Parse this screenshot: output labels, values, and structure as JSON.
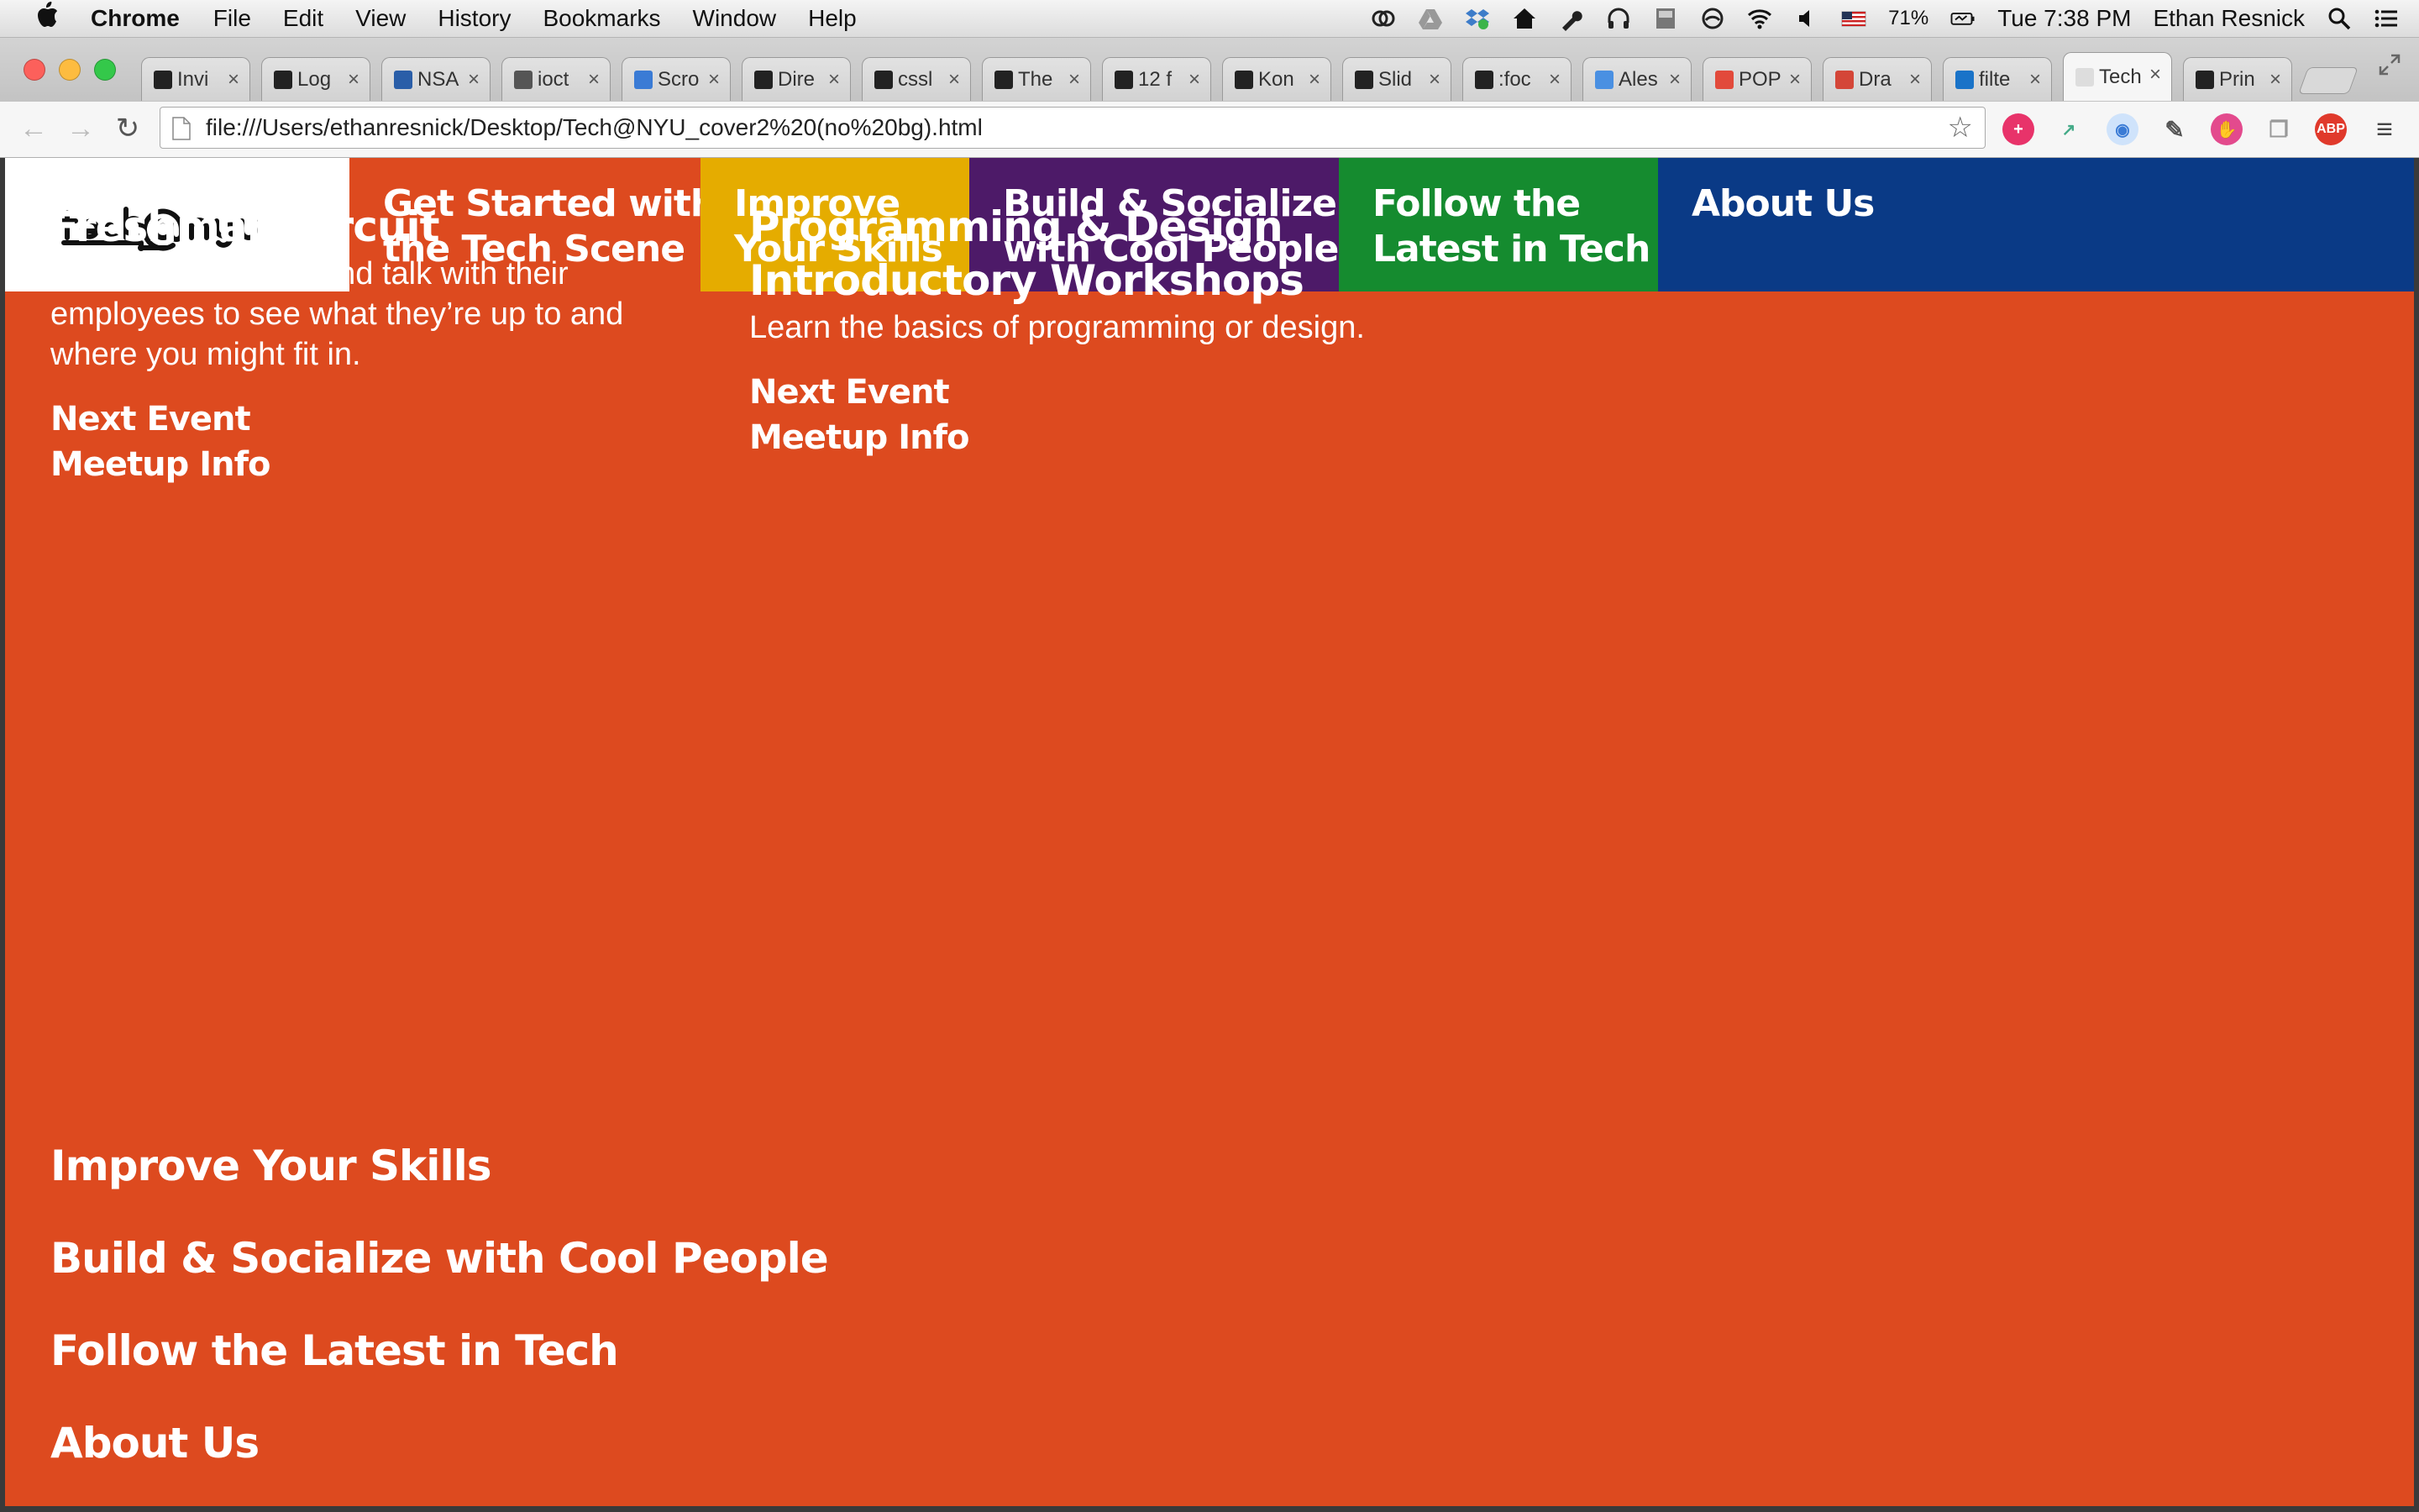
{
  "menubar": {
    "app_name": "Chrome",
    "items": [
      "File",
      "Edit",
      "View",
      "History",
      "Bookmarks",
      "Window",
      "Help"
    ],
    "battery": "71%",
    "clock": "Tue 7:38 PM",
    "user": "Ethan Resnick"
  },
  "browser": {
    "tabs": [
      {
        "title": "Invi",
        "favicon_color": "#222222",
        "favicon": "nyt-icon"
      },
      {
        "title": "Log",
        "favicon_color": "#222222",
        "favicon": "nyt-icon"
      },
      {
        "title": "NSA",
        "favicon_color": "#2a5ea8",
        "favicon": "g-icon"
      },
      {
        "title": "ioct",
        "favicon_color": "#555555",
        "favicon": "crane-icon"
      },
      {
        "title": "Scro",
        "favicon_color": "#3a7bd5",
        "favicon": "spinner-icon"
      },
      {
        "title": "Dire",
        "favicon_color": "#222222",
        "favicon": "codepen-icon"
      },
      {
        "title": "cssl",
        "favicon_color": "#222222",
        "favicon": "codepen-icon"
      },
      {
        "title": "The",
        "favicon_color": "#222222",
        "favicon": "codepen-icon"
      },
      {
        "title": "12 f",
        "favicon_color": "#222222",
        "favicon": "codepen-icon"
      },
      {
        "title": "Kon",
        "favicon_color": "#222222",
        "favicon": "codepen-icon"
      },
      {
        "title": "Slid",
        "favicon_color": "#222222",
        "favicon": "codepen-icon"
      },
      {
        "title": ":foc",
        "favicon_color": "#222222",
        "favicon": "codepen-icon"
      },
      {
        "title": "Ales",
        "favicon_color": "#4a90e2",
        "favicon": "d-icon"
      },
      {
        "title": "POP",
        "favicon_color": "#e24a3b",
        "favicon": "sun-icon"
      },
      {
        "title": "Dra",
        "favicon_color": "#d44638",
        "favicon": "gmail-icon"
      },
      {
        "title": "filte",
        "favicon_color": "#1a73c8",
        "favicon": "chat-icon"
      },
      {
        "title": "Tech",
        "favicon_color": "#dddddd",
        "favicon": "page-icon",
        "active": true
      },
      {
        "title": "Prin",
        "favicon_color": "#222222",
        "favicon": "github-icon"
      }
    ],
    "url": "file:///Users/ethanresnick/Desktop/Tech@NYU_cover2%20(no%20bg).html"
  },
  "site": {
    "logo_text": "tech@nyu",
    "nav": [
      {
        "line1": "Get Started with",
        "line2": "the Tech Scene",
        "color": "#dd4a1f"
      },
      {
        "line1": "Improve",
        "line2": "Your Skills",
        "color": "#e5ac00"
      },
      {
        "line1": "Build & Socialize",
        "line2": "with Cool People",
        "color": "#4d1a68"
      },
      {
        "line1": "Follow the",
        "line2": "Latest in Tech",
        "color": "#158b2f"
      },
      {
        "line1": "About Us",
        "line2": "",
        "color": "#0a3a86"
      }
    ],
    "background_color": "#dd4a1f",
    "sections": [
      {
        "title": "Freshman Circuit",
        "description": "Tour NYC startups and talk with their employees to see what they’re up to and where you might fit in.",
        "links": [
          "Next Event",
          "Meetup Info"
        ]
      },
      {
        "title_line1": "Programming & Design",
        "title_line2": "Introductory Workshops",
        "description": "Learn the basics of programming or design.",
        "links": [
          "Next Event",
          "Meetup Info"
        ]
      }
    ],
    "bottom_links": [
      "Improve Your Skills",
      "Build & Socialize with Cool People",
      "Follow the Latest in Tech",
      "About Us"
    ]
  }
}
